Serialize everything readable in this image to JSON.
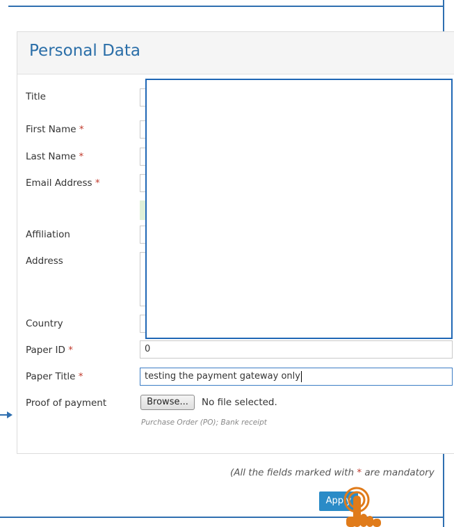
{
  "page": {
    "title": "Personal Data",
    "mandatory_note_prefix": "(All the fields marked with ",
    "mandatory_note_star": "*",
    "mandatory_note_suffix": " are mandatory"
  },
  "form": {
    "labels": {
      "title": "Title",
      "first_name": "First Name",
      "last_name": "Last Name",
      "email": "Email Address",
      "affiliation": "Affiliation",
      "address": "Address",
      "country": "Country",
      "paper_id": "Paper ID",
      "paper_title": "Paper Title",
      "proof_of_payment": "Proof of payment"
    },
    "required_marker": "*",
    "paper_id_value": "0",
    "paper_title_value": "testing the payment gateway only",
    "browse_label": "Browse...",
    "file_status": "No file selected.",
    "proof_hint": "Purchase Order (PO); Bank receipt"
  },
  "actions": {
    "apply_label": "Apply"
  },
  "colors": {
    "accent": "#2a6ea8",
    "button": "#2a8bc7",
    "required": "#c0392b",
    "pointer": "#e07b1a"
  }
}
